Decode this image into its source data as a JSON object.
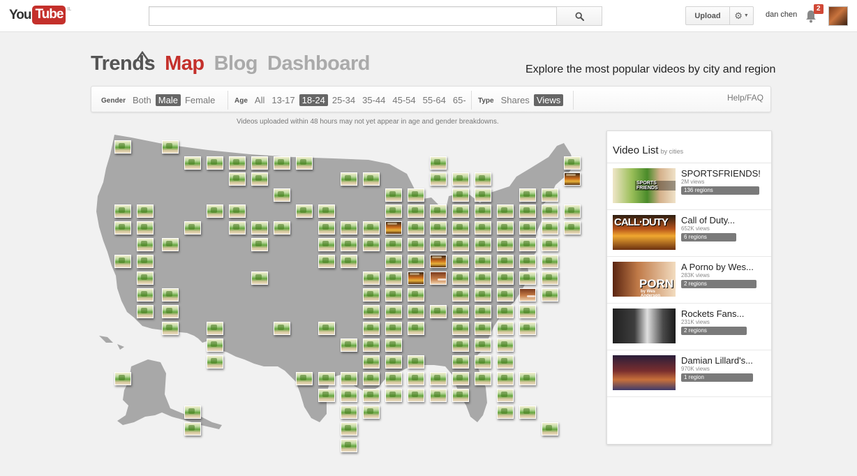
{
  "masthead": {
    "logo_you": "You",
    "logo_tube": "Tube",
    "country": "IL",
    "search_placeholder": "",
    "upload_label": "Upload",
    "user_name": "dan chen",
    "notification_count": "2"
  },
  "brand_nav": {
    "trends": "Trends",
    "map": "Map",
    "blog": "Blog",
    "dashboard": "Dashboard",
    "tagline": "Explore the most popular videos by city and region"
  },
  "filters": {
    "gender": {
      "label": "Gender",
      "options": [
        "Both",
        "Male",
        "Female"
      ],
      "selected": "Male"
    },
    "age": {
      "label": "Age",
      "options": [
        "All",
        "13-17",
        "18-24",
        "25-34",
        "35-44",
        "45-54",
        "55-64",
        "65-"
      ],
      "selected": "18-24"
    },
    "type": {
      "label": "Type",
      "options": [
        "Shares",
        "Views"
      ],
      "selected": "Views"
    },
    "help": "Help/FAQ",
    "notice": "Videos uploaded within 48 hours may not yet appear in age and gender breakdowns."
  },
  "video_list": {
    "title": "Video List",
    "subtitle": "by cities",
    "items": [
      {
        "title": "SPORTSFRIENDS!",
        "views": "2M views",
        "regions": "136 regions",
        "thumb_text": "SPORTS FRIENDS"
      },
      {
        "title": "Call of Duty...",
        "views": "652K views",
        "regions": "6 regions",
        "thumb_text": "CALL·DUTY"
      },
      {
        "title": "A Porno by Wes...",
        "views": "283K views",
        "regions": "2 regions",
        "thumb_text": "PORN",
        "thumb_sub": "by Wes Anderson"
      },
      {
        "title": "Rockets Fans...",
        "views": "231K views",
        "regions": "2 regions"
      },
      {
        "title": "Damian Lillard's...",
        "views": "970K views",
        "regions": "1 region"
      }
    ]
  },
  "colors": {
    "brand_red": "#c4302b",
    "map_fill": "#a8a8a8",
    "selected_filter": "#666666"
  },
  "icons": {
    "search": "magnifier-icon",
    "settings": "gear-icon",
    "notifications": "bell-icon"
  }
}
